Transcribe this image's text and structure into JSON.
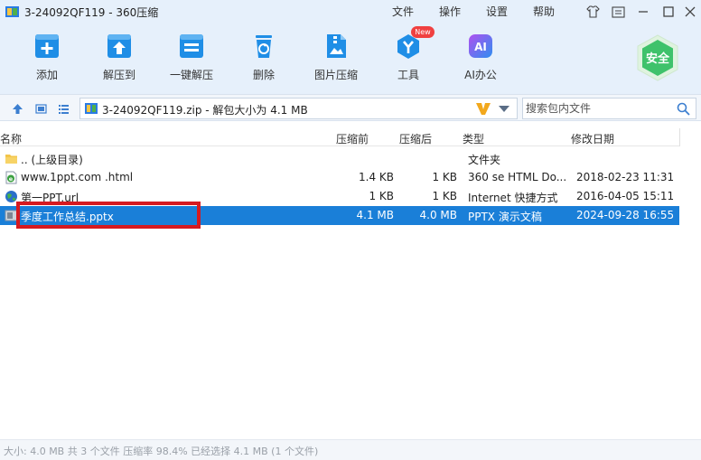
{
  "window": {
    "title": "3-24092QF119 - 360压缩",
    "menus": [
      "文件",
      "操作",
      "设置",
      "帮助"
    ]
  },
  "toolbar": {
    "items": [
      {
        "label": "添加",
        "icon": "add-icon"
      },
      {
        "label": "解压到",
        "icon": "extract-to-icon"
      },
      {
        "label": "一键解压",
        "icon": "one-click-extract-icon"
      },
      {
        "label": "删除",
        "icon": "trash-icon"
      },
      {
        "label": "图片压缩",
        "icon": "image-compress-icon"
      },
      {
        "label": "工具",
        "icon": "tools-icon"
      },
      {
        "label": "AI办公",
        "icon": "ai-office-icon"
      }
    ],
    "new_badge": "New",
    "ai_icon_text": "AI",
    "security_label": "安全"
  },
  "address": {
    "path": "3-24092QF119.zip - 解包大小为 4.1 MB",
    "search_placeholder": "搜索包内文件"
  },
  "file_list": {
    "columns": [
      "名称",
      "压缩前",
      "压缩后",
      "类型",
      "修改日期"
    ],
    "rows": [
      {
        "name": ".. (上级目录)",
        "before": "",
        "after": "",
        "type": "文件夹",
        "date": "",
        "icon": "folder-icon",
        "selected": false
      },
      {
        "name": "www.1ppt.com .html",
        "before": "1.4 KB",
        "after": "1 KB",
        "type": "360 se HTML Do...",
        "date": "2018-02-23 11:31",
        "icon": "html-file-icon",
        "selected": false
      },
      {
        "name": "第一PPT.url",
        "before": "1 KB",
        "after": "1 KB",
        "type": "Internet 快捷方式",
        "date": "2016-04-05 15:11",
        "icon": "globe-icon",
        "selected": false
      },
      {
        "name": "季度工作总结.pptx",
        "before": "4.1 MB",
        "after": "4.0 MB",
        "type": "PPTX 演示文稿",
        "date": "2024-09-28 16:55",
        "icon": "pptx-file-icon",
        "selected": true
      }
    ]
  },
  "status": {
    "text": "大小: 4.0 MB 共 3 个文件 压缩率 98.4% 已经选择 4.1 MB (1 个文件)"
  },
  "colors": {
    "accent": "#1a7fd8",
    "highlight_box": "#d61a20",
    "toolbar_icon": "#1f8ee6"
  }
}
